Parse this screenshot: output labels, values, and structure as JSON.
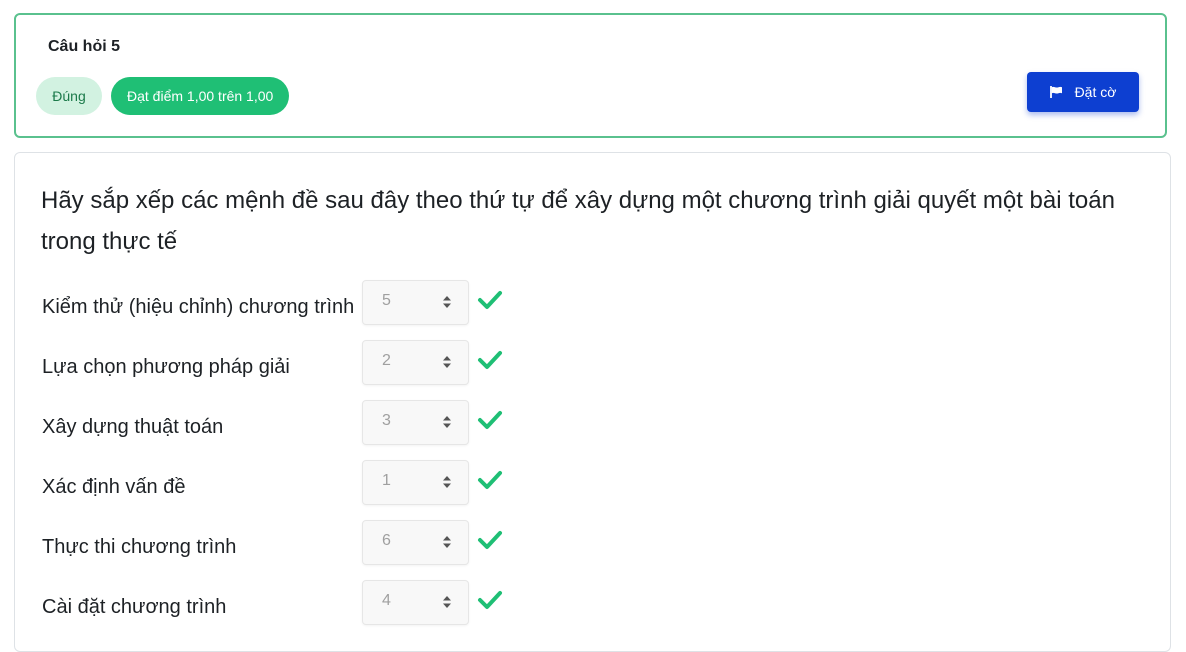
{
  "header": {
    "question_title": "Câu hỏi 5",
    "status_badge": "Đúng",
    "grade_badge": "Đạt điểm 1,00 trên 1,00",
    "flag_button": "Đặt cờ",
    "flag_icon": "flag-icon"
  },
  "question": {
    "text": "Hãy sắp xếp các mệnh đề sau đây theo thứ tự để xây dựng một chương trình giải quyết một bài toán trong thực tế"
  },
  "matches": [
    {
      "label": "Kiểm thử (hiệu chỉnh) chương trình",
      "value": "5",
      "correct": true
    },
    {
      "label": "Lựa chọn phương pháp giải",
      "value": "2",
      "correct": true
    },
    {
      "label": "Xây dựng thuật toán",
      "value": "3",
      "correct": true
    },
    {
      "label": "Xác định vấn đề",
      "value": "1",
      "correct": true
    },
    {
      "label": "Thực thi chương trình",
      "value": "6",
      "correct": true
    },
    {
      "label": "Cài đặt chương trình",
      "value": "4",
      "correct": true
    }
  ],
  "colors": {
    "correct_border": "#5ac18e",
    "grade_badge_bg": "#1fbf75",
    "status_badge_bg": "#d2f2e1",
    "flag_button_bg": "#0d3fd1",
    "check_color": "#1fbf75"
  },
  "icons": {
    "select_icon": "sort-icon",
    "correct_icon": "check-icon"
  }
}
